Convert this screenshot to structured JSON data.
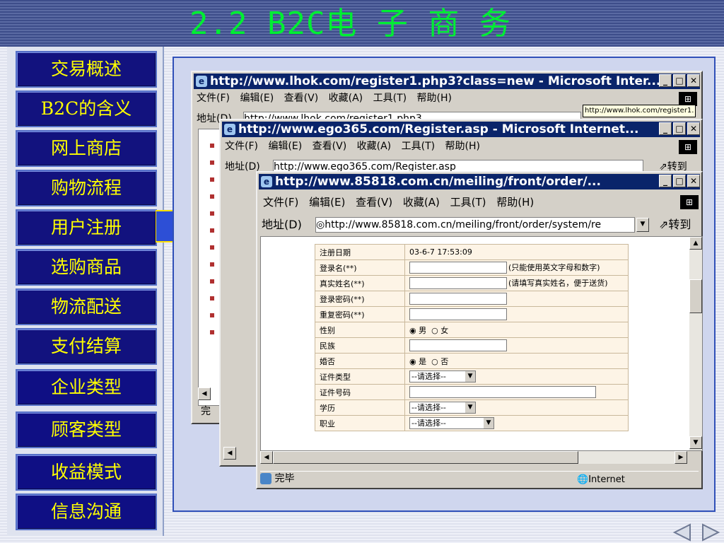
{
  "slide": {
    "title": "2.2 B2C电 子 商 务"
  },
  "sidebar": {
    "items": [
      "交易概述",
      "B2C的含义",
      "网上商店",
      "购物流程",
      "用户注册",
      "选购商品",
      "物流配送",
      "支付结算",
      "企业类型",
      "顾客类型",
      "收益模式",
      "信息沟通"
    ]
  },
  "browser_common": {
    "menu": [
      "文件(F)",
      "编辑(E)",
      "查看(V)",
      "收藏(A)",
      "工具(T)",
      "帮助(H)"
    ],
    "address_label": "地址(D)",
    "go_label": "转到"
  },
  "windows": {
    "back": {
      "title": "http://www.lhok.com/register1.php3?class=new - Microsoft Inter...",
      "tooltip": "http://www.lhok.com/register1.",
      "address_label": "地址(D)",
      "address": "http://www.lhok.com/register1.php3",
      "status": "完"
    },
    "middle": {
      "title": "http://www.ego365.com/Register.asp - Microsoft Internet...",
      "address": "http://www.ego365.com/Register.asp"
    },
    "front": {
      "title": "http://www.85818.com.cn/meiling/front/order/...",
      "address": "http://www.85818.com.cn/meiling/front/order/system/re",
      "status": "完毕",
      "zone": "Internet"
    }
  },
  "form": {
    "date_label": "注册日期",
    "date_value": "03-6-7 17:53:09",
    "login_label": "登录名(**)",
    "login_hint": "(只能使用英文字母和数字)",
    "realname_label": "真实姓名(**)",
    "realname_hint": "(请填写真实姓名，便于送货)",
    "password_label": "登录密码(**)",
    "password2_label": "重复密码(**)",
    "gender_label": "性别",
    "gender_male": "男",
    "gender_female": "女",
    "nation_label": "民族",
    "married_label": "婚否",
    "married_yes": "是",
    "married_no": "否",
    "idtype_label": "证件类型",
    "idtype_value": "--请选择--",
    "idnum_label": "证件号码",
    "edu_label": "学历",
    "edu_value": "--请选择--",
    "job_label": "职业",
    "job_value": "--请选择--"
  },
  "colors": {
    "title": "#00ee33",
    "nav_bg": "#12127e",
    "nav_text": "#ffff00",
    "titlebar": "#0a246a"
  }
}
